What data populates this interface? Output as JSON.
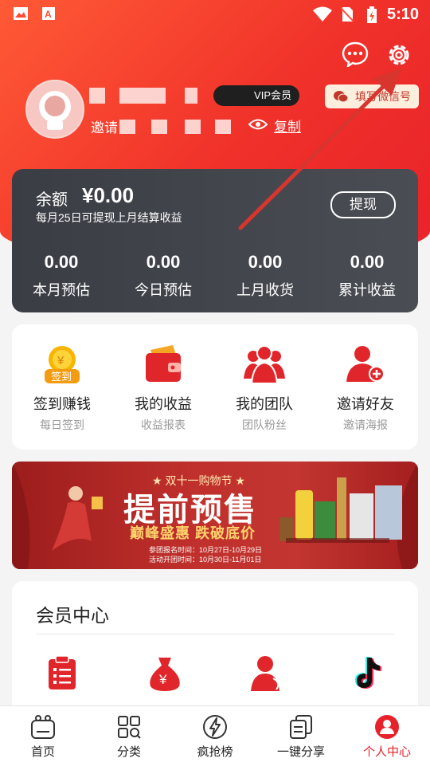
{
  "status_bar": {
    "time": "5:10",
    "icons": [
      "image-icon",
      "a-icon",
      "wifi-icon",
      "no-sim-icon",
      "battery-icon"
    ]
  },
  "header": {
    "vip_badge": "VIP会员",
    "invite_label": "邀请",
    "copy_label": "复制",
    "wechat_button": "填写微信号",
    "icons": [
      "message-icon",
      "gear-icon"
    ]
  },
  "balance": {
    "label": "余额",
    "amount": "¥0.00",
    "note": "每月25日可提现上月结算收益",
    "withdraw_button": "提现",
    "stats": [
      {
        "value": "0.00",
        "label": "本月预估"
      },
      {
        "value": "0.00",
        "label": "今日预估"
      },
      {
        "value": "0.00",
        "label": "上月收货"
      },
      {
        "value": "0.00",
        "label": "累计收益"
      }
    ]
  },
  "quick_actions": [
    {
      "title": "签到赚钱",
      "subtitle": "每日签到",
      "icon": "checkin-coin-icon",
      "icon_text": "签到"
    },
    {
      "title": "我的收益",
      "subtitle": "收益报表",
      "icon": "wallet-icon"
    },
    {
      "title": "我的团队",
      "subtitle": "团队粉丝",
      "icon": "team-icon"
    },
    {
      "title": "邀请好友",
      "subtitle": "邀请海报",
      "icon": "add-friend-icon"
    }
  ],
  "banner": {
    "tag": "★ 双十一购物节 ★",
    "headline": "提前预售",
    "subline": "巅峰盛惠  跌破底价",
    "date1": "参团报名时间：10月27日-10月29日",
    "date2": "活动开团时间：10月30日-11月01日"
  },
  "member_center": {
    "title": "会员中心",
    "icons": [
      "clipboard-icon",
      "money-bag-icon",
      "service-agent-icon",
      "tiktok-icon"
    ]
  },
  "bottom_nav": [
    {
      "label": "首页",
      "icon": "home-icon"
    },
    {
      "label": "分类",
      "icon": "category-icon"
    },
    {
      "label": "疯抢榜",
      "icon": "lightning-icon"
    },
    {
      "label": "一键分享",
      "icon": "share-icon"
    },
    {
      "label": "个人中心",
      "icon": "profile-icon",
      "active": true
    }
  ],
  "colors": {
    "brand_red": "#e8222a",
    "card_dark": "#43454d",
    "accent_gold": "#ffd36b"
  }
}
